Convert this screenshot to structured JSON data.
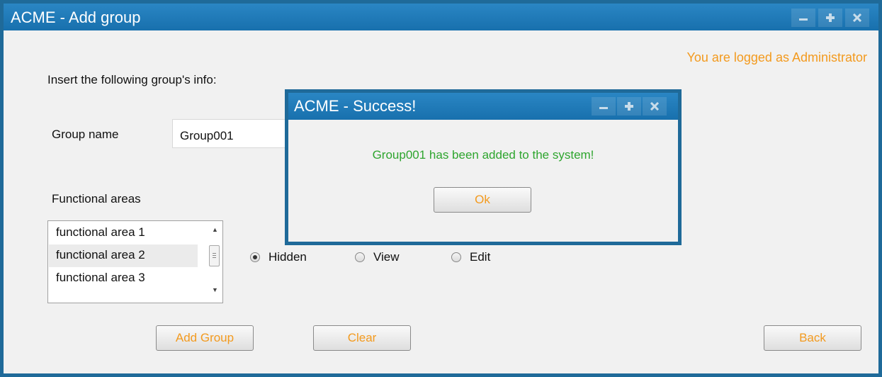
{
  "window": {
    "title": "ACME - Add group",
    "title_bar_color": "#1b75b3",
    "controls": [
      "minimize-icon",
      "maximize-icon",
      "close-icon"
    ]
  },
  "header": {
    "logged_text": "You are logged as Administrator"
  },
  "form": {
    "instruction": "Insert the following group's info:",
    "group_name_label": "Group name",
    "group_name_value": "Group001",
    "functional_areas_label": "Functional areas",
    "functional_areas": [
      {
        "label": "functional area 1",
        "selected": false
      },
      {
        "label": "functional area 2",
        "selected": true
      },
      {
        "label": "functional area 3",
        "selected": false
      }
    ],
    "access_options": [
      {
        "label": "Hidden",
        "checked": true
      },
      {
        "label": "View",
        "checked": false
      },
      {
        "label": "Edit",
        "checked": false
      }
    ]
  },
  "buttons": {
    "add_group": "Add Group",
    "clear": "Clear",
    "back": "Back"
  },
  "dialog": {
    "title": "ACME - Success!",
    "message": "Group001 has been added to the system!",
    "ok_label": "Ok"
  },
  "colors": {
    "accent": "#f39a1e",
    "success": "#2ea52e",
    "title_bar": "#1b75b3"
  }
}
